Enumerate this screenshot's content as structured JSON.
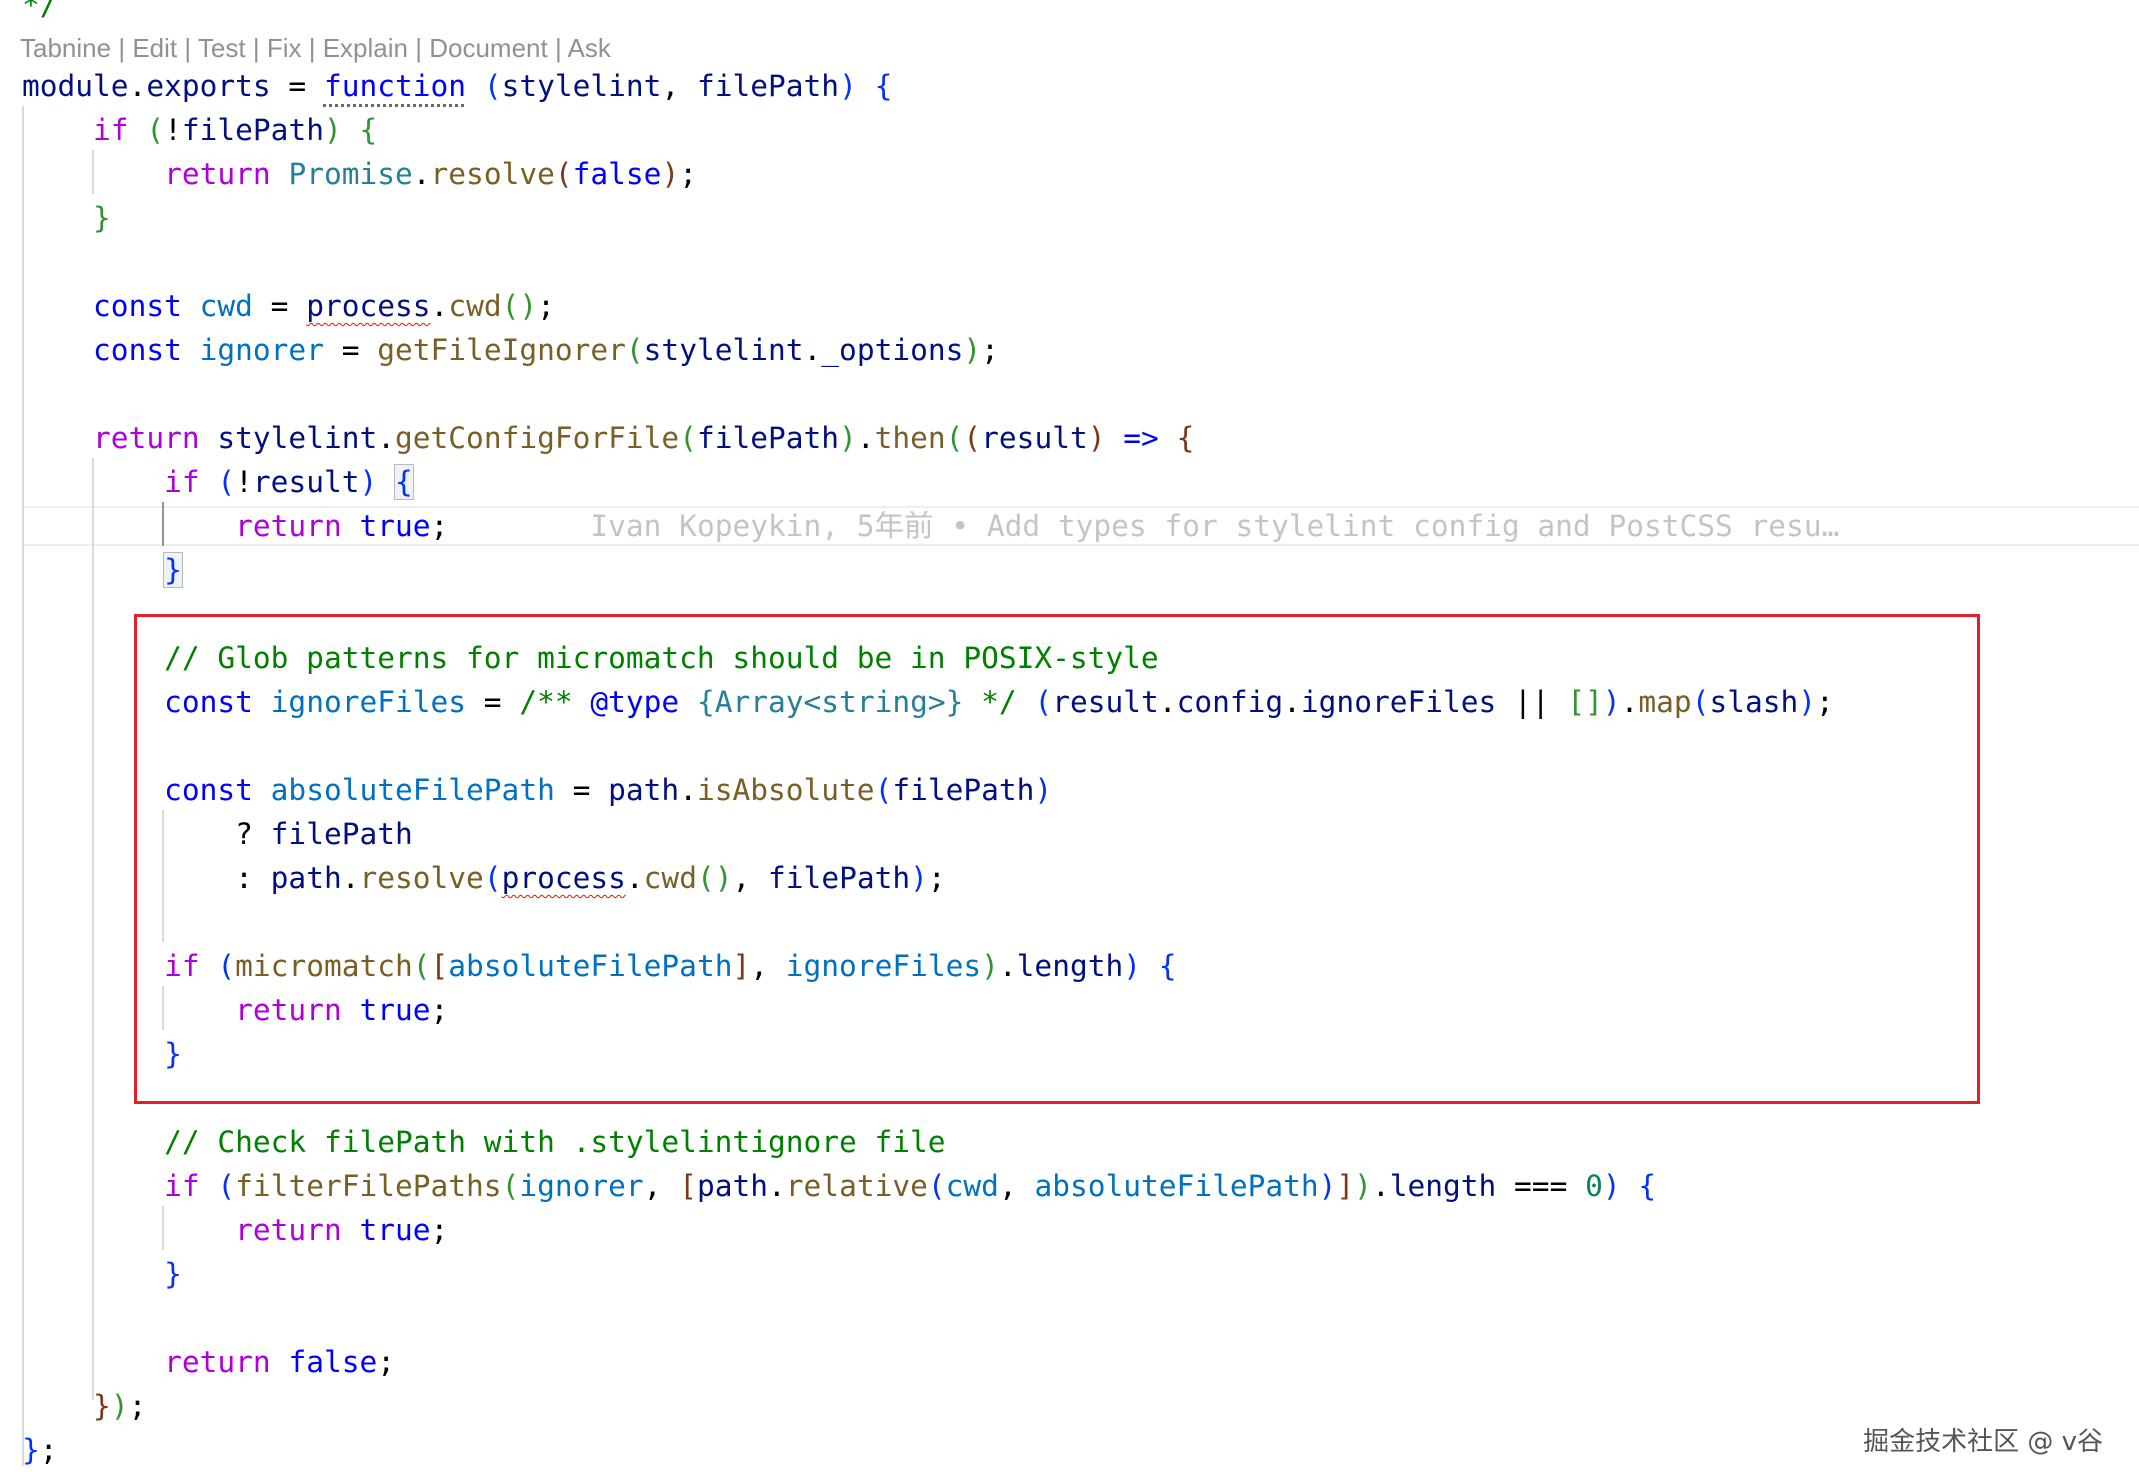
{
  "codelens": [
    "Tabnine",
    "Edit",
    "Test",
    "Fix",
    "Explain",
    "Document",
    "Ask"
  ],
  "codelens_separator": "|",
  "top_fragment": "*/",
  "blame_text": "Ivan Kopeykin, 5年前 • Add types for stylelint config and PostCSS resu…",
  "watermark": "掘金技术社区 @ v谷",
  "colors": {
    "keyword_blue": "#0000ff",
    "keyword_purple": "#af00db",
    "function": "#795e26",
    "variable": "#001080",
    "type": "#267f99",
    "comment": "#008000",
    "number": "#098658",
    "highlight_box": "#e0202a"
  },
  "code_lines": [
    [
      [
        "module",
        "var"
      ],
      [
        ".",
        "plain"
      ],
      [
        "exports",
        "var"
      ],
      [
        " = ",
        "plain"
      ],
      [
        "function",
        "kw-blue dots"
      ],
      [
        " (",
        "b1"
      ],
      [
        "stylelint",
        "var"
      ],
      [
        ", ",
        "plain"
      ],
      [
        "filePath",
        "var"
      ],
      [
        ")",
        "b1"
      ],
      [
        " ",
        "plain"
      ],
      [
        "{",
        "b1"
      ]
    ],
    [
      [
        "    ",
        "plain"
      ],
      [
        "if",
        "kw-purple"
      ],
      [
        " ",
        "plain"
      ],
      [
        "(",
        "b2"
      ],
      [
        "!",
        "plain"
      ],
      [
        "filePath",
        "var"
      ],
      [
        ")",
        "b2"
      ],
      [
        " ",
        "plain"
      ],
      [
        "{",
        "b2"
      ]
    ],
    [
      [
        "        ",
        "plain"
      ],
      [
        "return",
        "kw-purple"
      ],
      [
        " ",
        "plain"
      ],
      [
        "Promise",
        "type"
      ],
      [
        ".",
        "plain"
      ],
      [
        "resolve",
        "fn"
      ],
      [
        "(",
        "b3"
      ],
      [
        "false",
        "kw-blue"
      ],
      [
        ")",
        "b3"
      ],
      [
        ";",
        "plain"
      ]
    ],
    [
      [
        "    ",
        "plain"
      ],
      [
        "}",
        "b2"
      ]
    ],
    [],
    [
      [
        "    ",
        "plain"
      ],
      [
        "const",
        "kw-blue"
      ],
      [
        " ",
        "plain"
      ],
      [
        "cwd",
        "const-blue"
      ],
      [
        " = ",
        "plain"
      ],
      [
        "process",
        "var squiggle"
      ],
      [
        ".",
        "plain"
      ],
      [
        "cwd",
        "fn"
      ],
      [
        "()",
        "b2"
      ],
      [
        ";",
        "plain"
      ]
    ],
    [
      [
        "    ",
        "plain"
      ],
      [
        "const",
        "kw-blue"
      ],
      [
        " ",
        "plain"
      ],
      [
        "ignorer",
        "const-blue"
      ],
      [
        " = ",
        "plain"
      ],
      [
        "getFileIgnorer",
        "fn"
      ],
      [
        "(",
        "b2"
      ],
      [
        "stylelint",
        "var"
      ],
      [
        ".",
        "plain"
      ],
      [
        "_options",
        "var"
      ],
      [
        ")",
        "b2"
      ],
      [
        ";",
        "plain"
      ]
    ],
    [],
    [
      [
        "    ",
        "plain"
      ],
      [
        "return",
        "kw-purple"
      ],
      [
        " ",
        "plain"
      ],
      [
        "stylelint",
        "var"
      ],
      [
        ".",
        "plain"
      ],
      [
        "getConfigForFile",
        "fn"
      ],
      [
        "(",
        "b2"
      ],
      [
        "filePath",
        "var"
      ],
      [
        ")",
        "b2"
      ],
      [
        ".",
        "plain"
      ],
      [
        "then",
        "fn"
      ],
      [
        "(",
        "b2"
      ],
      [
        "(",
        "b3"
      ],
      [
        "result",
        "var"
      ],
      [
        ")",
        "b3"
      ],
      [
        " ",
        "plain"
      ],
      [
        "=>",
        "kw-blue"
      ],
      [
        " ",
        "plain"
      ],
      [
        "{",
        "b3"
      ]
    ],
    [
      [
        "        ",
        "plain"
      ],
      [
        "if",
        "kw-purple"
      ],
      [
        " ",
        "plain"
      ],
      [
        "(",
        "b1"
      ],
      [
        "!",
        "plain"
      ],
      [
        "result",
        "var"
      ],
      [
        ")",
        "b1"
      ],
      [
        " ",
        "plain"
      ],
      [
        "{",
        "b1 brk-match"
      ]
    ],
    [
      [
        "            ",
        "plain"
      ],
      [
        "return",
        "kw-purple"
      ],
      [
        " ",
        "plain"
      ],
      [
        "true",
        "kw-blue"
      ],
      [
        ";",
        "plain"
      ]
    ],
    [
      [
        "        ",
        "plain"
      ],
      [
        "}",
        "b1 brk-match"
      ]
    ],
    [],
    [
      [
        "        ",
        "plain"
      ],
      [
        "// Glob patterns for micromatch should be in POSIX-style",
        "cmt"
      ]
    ],
    [
      [
        "        ",
        "plain"
      ],
      [
        "const",
        "kw-blue"
      ],
      [
        " ",
        "plain"
      ],
      [
        "ignoreFiles",
        "const-blue"
      ],
      [
        " = ",
        "plain"
      ],
      [
        "/** ",
        "cmt"
      ],
      [
        "@type",
        "kw-blue"
      ],
      [
        " ",
        "cmt"
      ],
      [
        "{Array<string>}",
        "type"
      ],
      [
        " */",
        "cmt"
      ],
      [
        " ",
        "plain"
      ],
      [
        "(",
        "b1"
      ],
      [
        "result",
        "var"
      ],
      [
        ".",
        "plain"
      ],
      [
        "config",
        "var"
      ],
      [
        ".",
        "plain"
      ],
      [
        "ignoreFiles",
        "var"
      ],
      [
        " || ",
        "plain"
      ],
      [
        "[]",
        "b2"
      ],
      [
        ")",
        "b1"
      ],
      [
        ".",
        "plain"
      ],
      [
        "map",
        "fn"
      ],
      [
        "(",
        "b1"
      ],
      [
        "slash",
        "var"
      ],
      [
        ")",
        "b1"
      ],
      [
        ";",
        "plain"
      ]
    ],
    [],
    [
      [
        "        ",
        "plain"
      ],
      [
        "const",
        "kw-blue"
      ],
      [
        " ",
        "plain"
      ],
      [
        "absoluteFilePath",
        "const-blue"
      ],
      [
        " = ",
        "plain"
      ],
      [
        "path",
        "var"
      ],
      [
        ".",
        "plain"
      ],
      [
        "isAbsolute",
        "fn"
      ],
      [
        "(",
        "b1"
      ],
      [
        "filePath",
        "var"
      ],
      [
        ")",
        "b1"
      ]
    ],
    [
      [
        "            ",
        "plain"
      ],
      [
        "? ",
        "plain"
      ],
      [
        "filePath",
        "var"
      ]
    ],
    [
      [
        "            ",
        "plain"
      ],
      [
        ": ",
        "plain"
      ],
      [
        "path",
        "var"
      ],
      [
        ".",
        "plain"
      ],
      [
        "resolve",
        "fn"
      ],
      [
        "(",
        "b1"
      ],
      [
        "process",
        "var squiggle"
      ],
      [
        ".",
        "plain"
      ],
      [
        "cwd",
        "fn"
      ],
      [
        "()",
        "b2"
      ],
      [
        ", ",
        "plain"
      ],
      [
        "filePath",
        "var"
      ],
      [
        ")",
        "b1"
      ],
      [
        ";",
        "plain"
      ]
    ],
    [],
    [
      [
        "        ",
        "plain"
      ],
      [
        "if",
        "kw-purple"
      ],
      [
        " ",
        "plain"
      ],
      [
        "(",
        "b1"
      ],
      [
        "micromatch",
        "fn"
      ],
      [
        "(",
        "b2"
      ],
      [
        "[",
        "b3"
      ],
      [
        "absoluteFilePath",
        "const-blue"
      ],
      [
        "]",
        "b3"
      ],
      [
        ", ",
        "plain"
      ],
      [
        "ignoreFiles",
        "const-blue"
      ],
      [
        ")",
        "b2"
      ],
      [
        ".",
        "plain"
      ],
      [
        "length",
        "var"
      ],
      [
        ")",
        "b1"
      ],
      [
        " ",
        "plain"
      ],
      [
        "{",
        "b1"
      ]
    ],
    [
      [
        "            ",
        "plain"
      ],
      [
        "return",
        "kw-purple"
      ],
      [
        " ",
        "plain"
      ],
      [
        "true",
        "kw-blue"
      ],
      [
        ";",
        "plain"
      ]
    ],
    [
      [
        "        ",
        "plain"
      ],
      [
        "}",
        "b1"
      ]
    ],
    [],
    [
      [
        "        ",
        "plain"
      ],
      [
        "// Check filePath with .stylelintignore file",
        "cmt"
      ]
    ],
    [
      [
        "        ",
        "plain"
      ],
      [
        "if",
        "kw-purple"
      ],
      [
        " ",
        "plain"
      ],
      [
        "(",
        "b1"
      ],
      [
        "filterFilePaths",
        "fn"
      ],
      [
        "(",
        "b2"
      ],
      [
        "ignorer",
        "const-blue"
      ],
      [
        ", ",
        "plain"
      ],
      [
        "[",
        "b3"
      ],
      [
        "path",
        "var"
      ],
      [
        ".",
        "plain"
      ],
      [
        "relative",
        "fn"
      ],
      [
        "(",
        "b1"
      ],
      [
        "cwd",
        "const-blue"
      ],
      [
        ", ",
        "plain"
      ],
      [
        "absoluteFilePath",
        "const-blue"
      ],
      [
        ")",
        "b1"
      ],
      [
        "]",
        "b3"
      ],
      [
        ")",
        "b2"
      ],
      [
        ".",
        "plain"
      ],
      [
        "length",
        "var"
      ],
      [
        " === ",
        "plain"
      ],
      [
        "0",
        "num"
      ],
      [
        ")",
        "b1"
      ],
      [
        " ",
        "plain"
      ],
      [
        "{",
        "b1"
      ]
    ],
    [
      [
        "            ",
        "plain"
      ],
      [
        "return",
        "kw-purple"
      ],
      [
        " ",
        "plain"
      ],
      [
        "true",
        "kw-blue"
      ],
      [
        ";",
        "plain"
      ]
    ],
    [
      [
        "        ",
        "plain"
      ],
      [
        "}",
        "b1"
      ]
    ],
    [],
    [
      [
        "        ",
        "plain"
      ],
      [
        "return",
        "kw-purple"
      ],
      [
        " ",
        "plain"
      ],
      [
        "false",
        "kw-blue"
      ],
      [
        ";",
        "plain"
      ]
    ],
    [
      [
        "    ",
        "plain"
      ],
      [
        "}",
        "b3"
      ],
      [
        ")",
        "b2"
      ],
      [
        ";",
        "plain"
      ]
    ],
    [
      [
        "}",
        "b1"
      ],
      [
        ";",
        "plain"
      ]
    ]
  ]
}
